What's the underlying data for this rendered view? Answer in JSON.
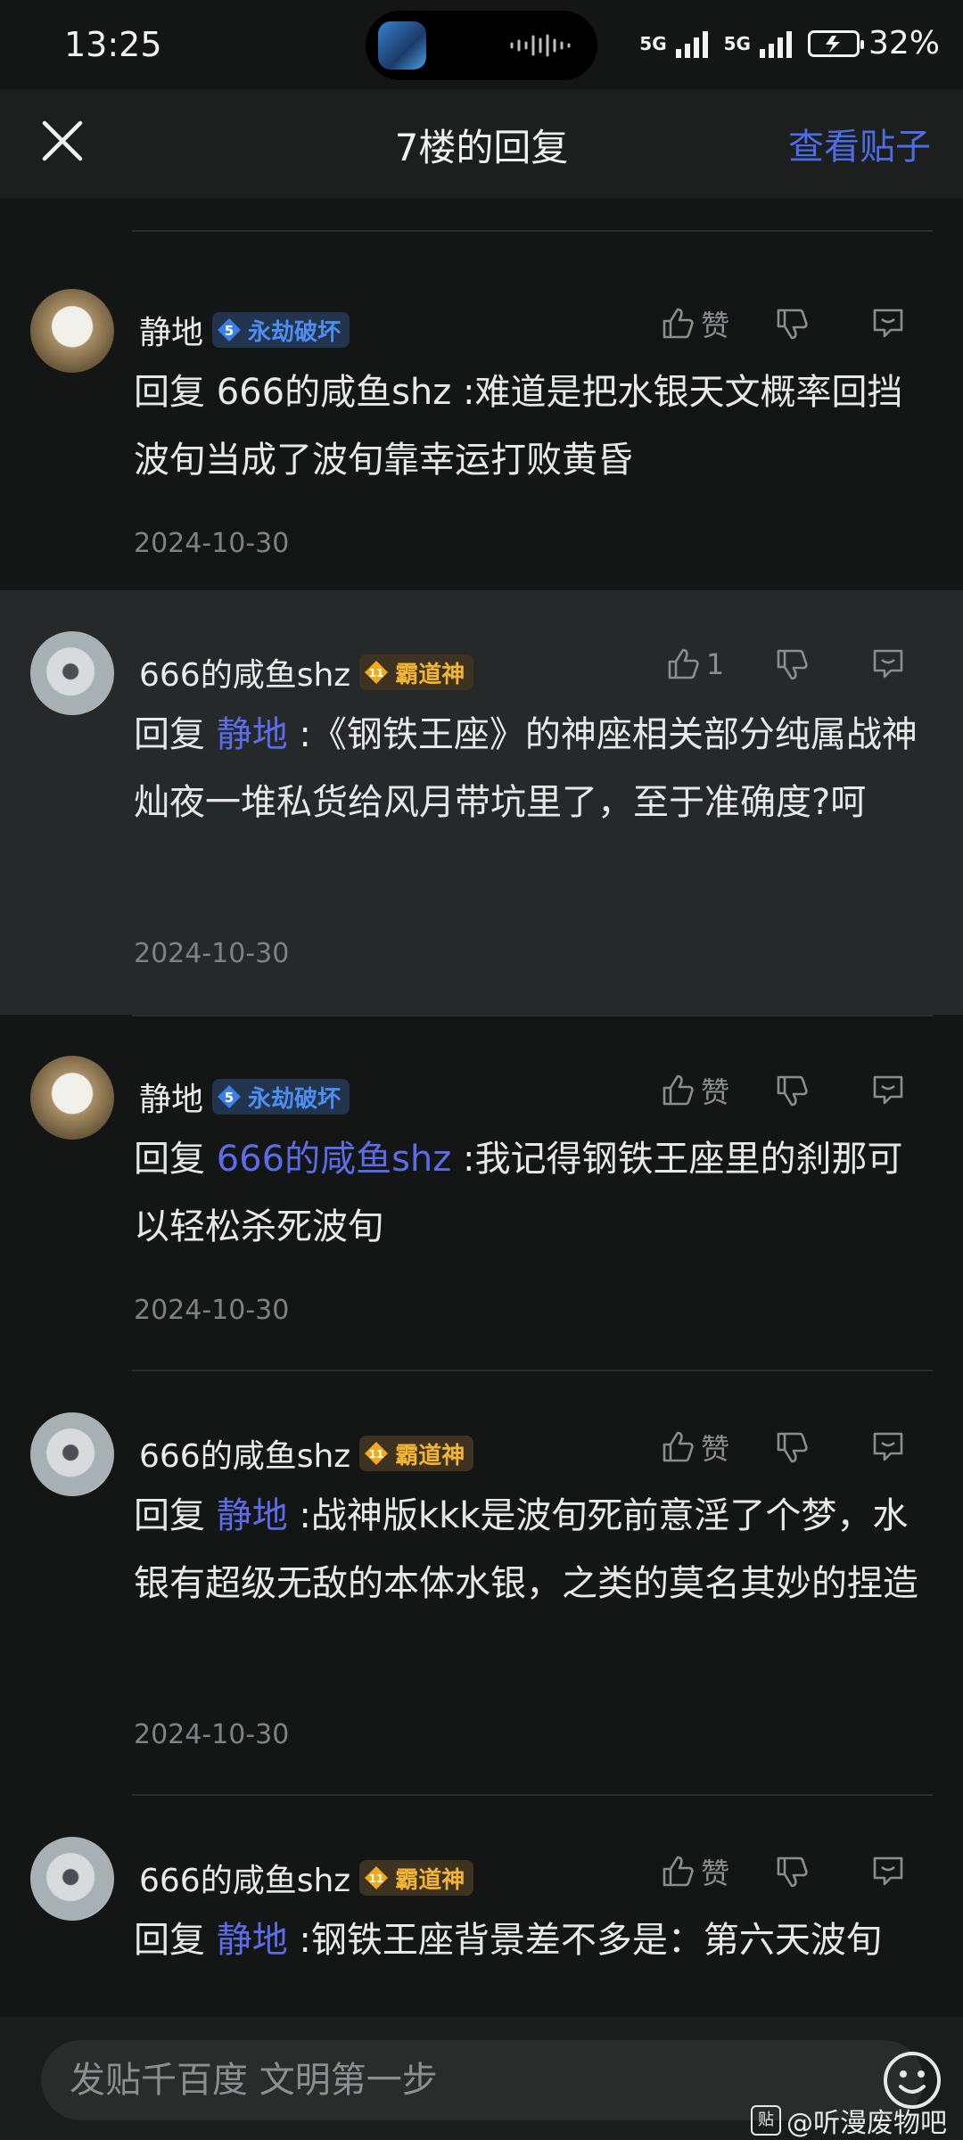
{
  "status": {
    "time": "13:25",
    "net1": "5G",
    "net2": "5G",
    "battery": "32%"
  },
  "header": {
    "title": "7楼的回复",
    "view_post": "查看贴子"
  },
  "comments": [
    {
      "user": "静地",
      "level": "5",
      "badge": "永劫破坏",
      "badge_color": "#4d8ff0",
      "like": "赞",
      "reply_prefix": "回复 ",
      "reply_to": "666的咸鱼shz",
      "text": " :难道是把水银天文概率回挡波旬当成了波旬靠幸运打败黄昏",
      "date": "2024-10-30"
    },
    {
      "user": "666的咸鱼shz",
      "level": "11",
      "badge": "霸道神",
      "badge_color": "#f2b431",
      "like": "1",
      "reply_prefix": "回复 ",
      "reply_to": "静地",
      "text": " :《钢铁王座》的神座相关部分纯属战神灿夜一堆私货给风月带坑里了，至于准确度?呵",
      "date": "2024-10-30"
    },
    {
      "user": "静地",
      "level": "5",
      "badge": "永劫破坏",
      "badge_color": "#4d8ff0",
      "like": "赞",
      "reply_prefix": "回复 ",
      "reply_to": "666的咸鱼shz",
      "text": " :我记得钢铁王座里的刹那可以轻松杀死波旬",
      "date": "2024-10-30"
    },
    {
      "user": "666的咸鱼shz",
      "level": "11",
      "badge": "霸道神",
      "badge_color": "#f2b431",
      "like": "赞",
      "reply_prefix": "回复 ",
      "reply_to": "静地",
      "text": " :战神版kkk是波旬死前意淫了个梦，水银有超级无敌的本体水银，之类的莫名其妙的捏造",
      "date": "2024-10-30"
    },
    {
      "user": "666的咸鱼shz",
      "level": "11",
      "badge": "霸道神",
      "badge_color": "#f2b431",
      "like": "赞",
      "reply_prefix": "回复 ",
      "reply_to": "静地",
      "text": " :钢铁王座背景差不多是：第六天波旬",
      "date": ""
    }
  ],
  "input": {
    "placeholder": "发贴千百度 文明第一步"
  },
  "watermark": {
    "logo": "贴",
    "text": "@听漫废物吧"
  },
  "colors": {
    "accent": "#4d6de8",
    "mention": "#5a6ce8",
    "background": "#141616"
  }
}
